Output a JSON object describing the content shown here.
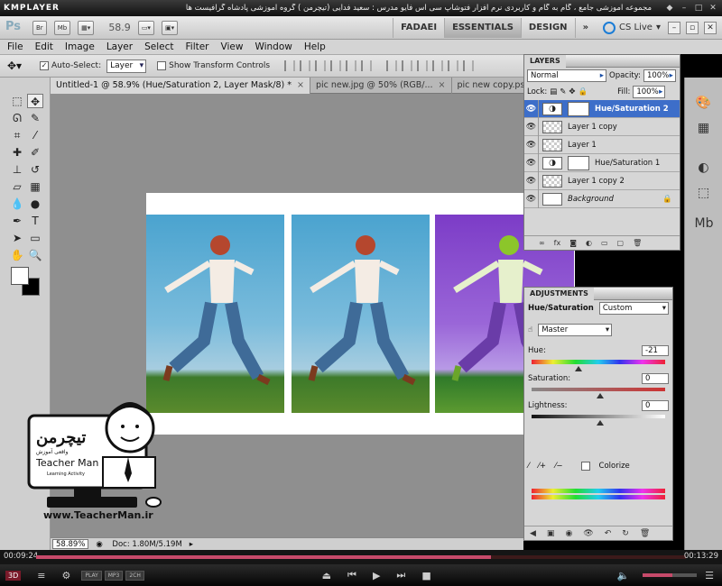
{
  "player": {
    "logo": "KMPLAYER",
    "caption": "مجموعه آموزشی جامع ، گام به گام و کاربردی نرم افزار فتوشاپ سی اس فایو  مدرس : سعید فدایی (تیچرمن ) گروه آموزشی پادشاه گرافیست ها",
    "time_elapsed": "00:09:24",
    "time_total": "00:13:29",
    "progress": 0.7,
    "volume": 0.55,
    "badges": [
      "PLAY",
      "MP3",
      "2CH"
    ],
    "mode_3d": "3D"
  },
  "appbar": {
    "logo": "Ps",
    "bridge_label": "Br",
    "minibridge_label": "Mb",
    "zoom": "58.9",
    "workspaces": [
      "FADAEI",
      "ESSENTIALS",
      "DESIGN"
    ],
    "active_workspace": "ESSENTIALS",
    "cs_live": "CS Live"
  },
  "menu": [
    "File",
    "Edit",
    "Image",
    "Layer",
    "Select",
    "Filter",
    "View",
    "Window",
    "Help"
  ],
  "options": {
    "auto_select_label": "Auto-Select:",
    "auto_select_value": "Layer",
    "show_transform_label": "Show Transform Controls"
  },
  "doc_tabs": [
    {
      "label": "Untitled-1 @ 58.9% (Hue/Saturation 2, Layer Mask/8) *",
      "close": "×"
    },
    {
      "label": "pic new.jpg @ 50% (RGB/...",
      "close": "×"
    },
    {
      "label": "pic new copy.psd @ 50% (R...",
      "close": "×"
    }
  ],
  "status": {
    "zoom": "58.89%",
    "doc": "Doc: 1.80M/5.19M"
  },
  "layers_panel": {
    "tab": "LAYERS",
    "blend_mode": "Normal",
    "opacity_label": "Opacity:",
    "opacity": "100%",
    "lock_label": "Lock:",
    "fill_label": "Fill:",
    "fill": "100%",
    "layers": [
      {
        "name": "Hue/Saturation 2",
        "type": "adjustment",
        "active": true
      },
      {
        "name": "Layer 1 copy",
        "type": "pixel",
        "active": false
      },
      {
        "name": "Layer 1",
        "type": "pixel",
        "active": false
      },
      {
        "name": "Hue/Saturation 1",
        "type": "adjustment",
        "active": false
      },
      {
        "name": "Layer 1 copy 2",
        "type": "pixel",
        "active": false
      },
      {
        "name": "Background",
        "type": "background",
        "active": false
      }
    ],
    "footer_icons": [
      "link-icon",
      "fx-icon",
      "mask-icon",
      "adjustment-icon",
      "group-icon",
      "new-layer-icon",
      "trash-icon"
    ]
  },
  "adjustments_panel": {
    "tab": "ADJUSTMENTS",
    "title": "Hue/Saturation",
    "preset": "Custom",
    "channel": "Master",
    "hue_label": "Hue:",
    "hue": "-21",
    "saturation_label": "Saturation:",
    "saturation": "0",
    "lightness_label": "Lightness:",
    "lightness": "0",
    "colorize_label": "Colorize"
  },
  "logo": {
    "persian": "تیچرمن",
    "tagline": "واقعی آموزش",
    "name": "Teacher Man",
    "sub": "Learning Activity",
    "url": "www.TeacherMan.ir"
  },
  "colors": {
    "accent": "#3d6ec9",
    "player_accent": "#c74a6a"
  }
}
